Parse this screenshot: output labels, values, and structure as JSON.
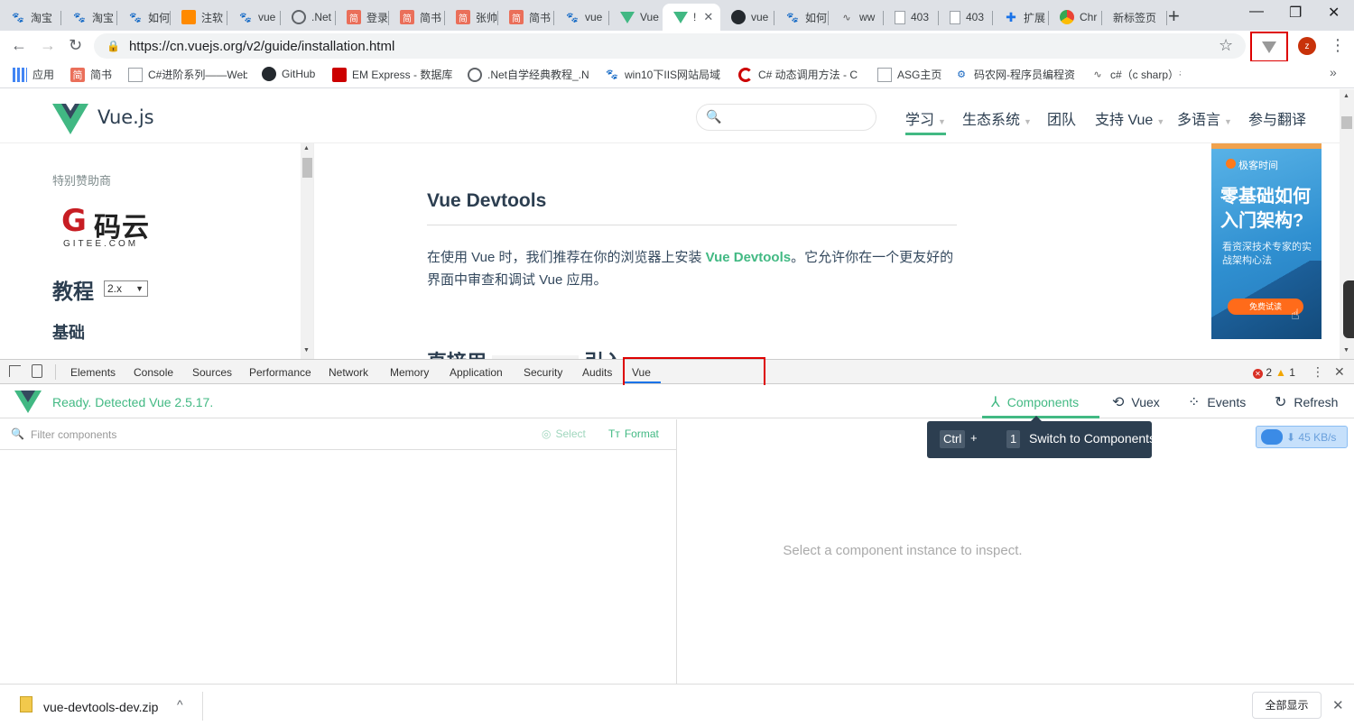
{
  "browser": {
    "tabs": [
      {
        "title": "淘宝",
        "icon": "baidu-paw-icon"
      },
      {
        "title": "淘宝",
        "icon": "baidu-paw-icon"
      },
      {
        "title": "如何",
        "icon": "baidu-paw-icon"
      },
      {
        "title": "注软",
        "icon": "orange-favicon-icon"
      },
      {
        "title": "vue",
        "icon": "baidu-paw-icon"
      },
      {
        "title": ".Net",
        "icon": "globe-icon"
      },
      {
        "title": "登录",
        "icon": "jianshu-icon"
      },
      {
        "title": "简书",
        "icon": "jianshu-icon"
      },
      {
        "title": "张帅",
        "icon": "jianshu-icon"
      },
      {
        "title": "简书",
        "icon": "jianshu-icon"
      },
      {
        "title": "vue",
        "icon": "baidu-paw-icon"
      },
      {
        "title": "Vue",
        "icon": "vue-icon"
      },
      {
        "title": "!",
        "icon": "vue-icon",
        "active": true
      },
      {
        "title": "vue",
        "icon": "github-icon"
      },
      {
        "title": "如何",
        "icon": "baidu-paw-icon"
      },
      {
        "title": "ww",
        "icon": "wave-icon"
      },
      {
        "title": "403",
        "icon": "document-icon"
      },
      {
        "title": "403",
        "icon": "document-icon"
      },
      {
        "title": "扩展",
        "icon": "puzzle-icon"
      },
      {
        "title": "Chr",
        "icon": "chrome-icon"
      },
      {
        "title": "新标签页",
        "icon": ""
      }
    ],
    "new_tab": "+",
    "url": "https://cn.vuejs.org/v2/guide/installation.html",
    "profile_initial": "z",
    "bookmarks": [
      {
        "label": "应用",
        "icon": "apps-grid-icon"
      },
      {
        "label": "简书",
        "icon": "jianshu-icon"
      },
      {
        "label": "C#进阶系列——Web",
        "icon": "bookmark-page-icon"
      },
      {
        "label": "GitHub",
        "icon": "github-icon"
      },
      {
        "label": "EM Express - 数据库",
        "icon": "oracle-icon"
      },
      {
        "label": ".Net自学经典教程_.N",
        "icon": "globe-icon"
      },
      {
        "label": "win10下IIS网站局域",
        "icon": "baidu-paw-icon"
      },
      {
        "label": "C# 动态调用方法 - C",
        "icon": "csdn-icon"
      },
      {
        "label": "ASG主页",
        "icon": "document-icon"
      },
      {
        "label": "码农网-程序员编程资",
        "icon": "codemonkey-icon"
      },
      {
        "label": "c#（c sharp）书籍推",
        "icon": "wave-icon"
      }
    ],
    "bookmarks_more": "»"
  },
  "site": {
    "logo_text": "Vue.js",
    "nav": [
      {
        "label": "学习",
        "caret": true
      },
      {
        "label": "生态系统",
        "caret": true
      },
      {
        "label": "团队",
        "caret": false
      },
      {
        "label": "支持 Vue",
        "caret": true
      },
      {
        "label": "多语言",
        "caret": true
      },
      {
        "label": "参与翻译",
        "caret": false
      }
    ],
    "sidebar": {
      "sponsor_label": "特别赞助商",
      "sponsor_logo_mark": "G",
      "sponsor_logo_cn": "码云",
      "sponsor_logo_en": "GITEE.COM",
      "tutorial_heading": "教程",
      "version": "2.x",
      "basics_heading": "基础"
    },
    "content": {
      "heading": "Vue Devtools",
      "para_before": "在使用 Vue 时，我们推荐在你的浏览器上安装 ",
      "para_link": "Vue Devtools",
      "para_after": "。它允许你在一个更友好的界面中审查和调试 Vue 应用。",
      "next_heading_start": "直接用",
      "next_heading_end": "引入"
    },
    "ad": {
      "brand": "极客时间",
      "headline": "零基础如何入门架构?",
      "sub": "看资深技术专家的实战架构心法",
      "cta": "免费试读"
    }
  },
  "devtools": {
    "tabs": [
      "Elements",
      "Console",
      "Sources",
      "Performance",
      "Network",
      "Memory",
      "Application",
      "Security",
      "Audits",
      "Vue"
    ],
    "active_tab": "Vue",
    "error_count": "2",
    "warning_count": "1",
    "vue": {
      "status": "Ready. Detected Vue 2.5.17.",
      "nav": [
        {
          "label": "Components",
          "icon": "components-icon",
          "active": true
        },
        {
          "label": "Vuex",
          "icon": "history-icon"
        },
        {
          "label": "Events",
          "icon": "events-icon"
        },
        {
          "label": "Refresh",
          "icon": "refresh-icon"
        }
      ],
      "filter_placeholder": "Filter components",
      "select_label": "Select",
      "format_label": "Format",
      "empty_text": "Select a component instance to inspect.",
      "tooltip": {
        "key1": "Ctrl",
        "plus": "+",
        "key2": "1",
        "message": "Switch to Components"
      },
      "network_speed": "45 KB/s"
    }
  },
  "downloads": {
    "file": "vue-devtools-dev.zip",
    "show_all": "全部显示"
  },
  "colors": {
    "vue_green": "#42b983",
    "vue_dark": "#2c3e50",
    "highlight_red": "#dd0000"
  }
}
